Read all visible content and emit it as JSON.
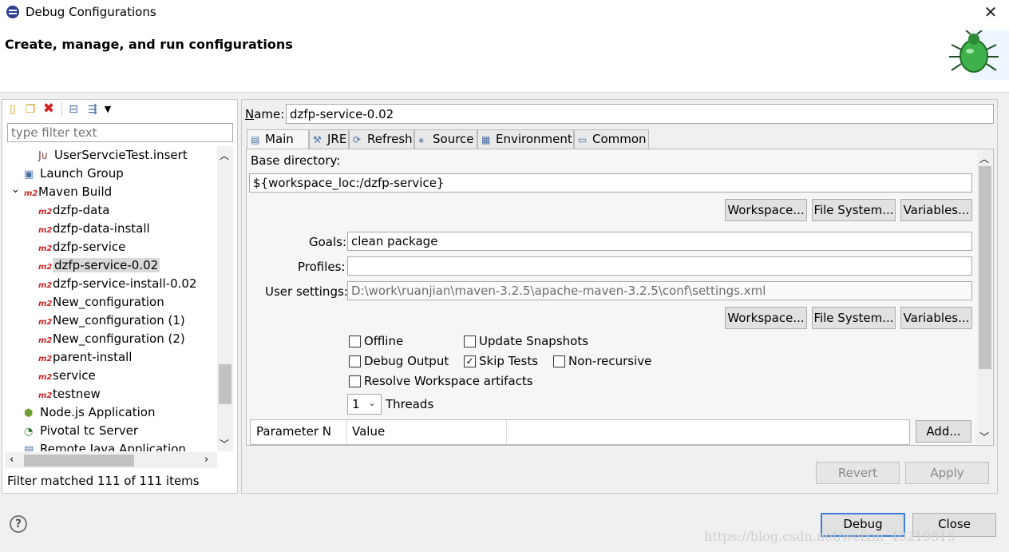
{
  "window": {
    "title": "Debug Configurations",
    "close_glyph": "✕"
  },
  "header": {
    "title": "Create, manage, and run configurations"
  },
  "left": {
    "filter_placeholder": "type filter text",
    "tree": [
      {
        "label": "UserServcieTest.insert",
        "icon": "junit-icon",
        "glyph": "Jᴜ",
        "indent": 2
      },
      {
        "label": "Launch Group",
        "icon": "launch-group-icon",
        "glyph": "▣",
        "indent": 1
      },
      {
        "label": "Maven Build",
        "icon": "maven-icon",
        "glyph": "m2",
        "indent": 1,
        "expander": "⌄"
      },
      {
        "label": "dzfp-data",
        "icon": "maven-icon",
        "glyph": "m2",
        "indent": 2
      },
      {
        "label": "dzfp-data-install",
        "icon": "maven-icon",
        "glyph": "m2",
        "indent": 2
      },
      {
        "label": "dzfp-service",
        "icon": "maven-icon",
        "glyph": "m2",
        "indent": 2
      },
      {
        "label": "dzfp-service-0.02",
        "icon": "maven-icon",
        "glyph": "m2",
        "indent": 2,
        "selected": true
      },
      {
        "label": "dzfp-service-install-0.02",
        "icon": "maven-icon",
        "glyph": "m2",
        "indent": 2
      },
      {
        "label": "New_configuration",
        "icon": "maven-icon",
        "glyph": "m2",
        "indent": 2
      },
      {
        "label": "New_configuration (1)",
        "icon": "maven-icon",
        "glyph": "m2",
        "indent": 2
      },
      {
        "label": "New_configuration (2)",
        "icon": "maven-icon",
        "glyph": "m2",
        "indent": 2
      },
      {
        "label": "parent-install",
        "icon": "maven-icon",
        "glyph": "m2",
        "indent": 2
      },
      {
        "label": "service",
        "icon": "maven-icon",
        "glyph": "m2",
        "indent": 2
      },
      {
        "label": "testnew",
        "icon": "maven-icon",
        "glyph": "m2",
        "indent": 2
      },
      {
        "label": "Node.js Application",
        "icon": "nodejs-icon",
        "glyph": "⬢",
        "indent": 1
      },
      {
        "label": "Pivotal tc Server",
        "icon": "pivotal-icon",
        "glyph": "◔",
        "indent": 1
      },
      {
        "label": "Remote Java Application",
        "icon": "remote-java-icon",
        "glyph": "▤",
        "indent": 1
      }
    ],
    "status": "Filter matched 111 of 111 items"
  },
  "right": {
    "name_label": "Name:",
    "name_value": "dzfp-service-0.02",
    "tabs": [
      {
        "label": "Main",
        "glyph": "▤"
      },
      {
        "label": "JRE",
        "glyph": "⚒"
      },
      {
        "label": "Refresh",
        "glyph": "⟳"
      },
      {
        "label": "Source",
        "glyph": "⚹"
      },
      {
        "label": "Environment",
        "glyph": "▦"
      },
      {
        "label": "Common",
        "glyph": "▭"
      }
    ],
    "base_dir_label": "Base directory:",
    "base_dir_value": "${workspace_loc:/dzfp-service}",
    "btn_workspace": "Workspace...",
    "btn_filesystem": "File System...",
    "btn_variables": "Variables...",
    "goals_label": "Goals:",
    "goals_value": "clean package",
    "profiles_label": "Profiles:",
    "profiles_value": "",
    "user_settings_label": "User settings:",
    "user_settings_value": "D:\\work\\ruanjian\\maven-3.2.5\\apache-maven-3.2.5\\conf\\settings.xml",
    "checks": {
      "offline": "Offline",
      "update_snapshots": "Update Snapshots",
      "debug_output": "Debug Output",
      "skip_tests": "Skip Tests",
      "non_recursive": "Non-recursive",
      "resolve_workspace": "Resolve Workspace artifacts",
      "check_glyph": "✓"
    },
    "threads_value": "1",
    "threads_label": "Threads",
    "table_headers": [
      "Parameter N",
      "Value"
    ],
    "btn_add": "Add...",
    "btn_revert": "Revert",
    "btn_apply": "Apply"
  },
  "footer": {
    "help_glyph": "?",
    "btn_debug": "Debug",
    "btn_close": "Close",
    "watermark": "https://blog.csdn.net/weixin_40219515"
  }
}
